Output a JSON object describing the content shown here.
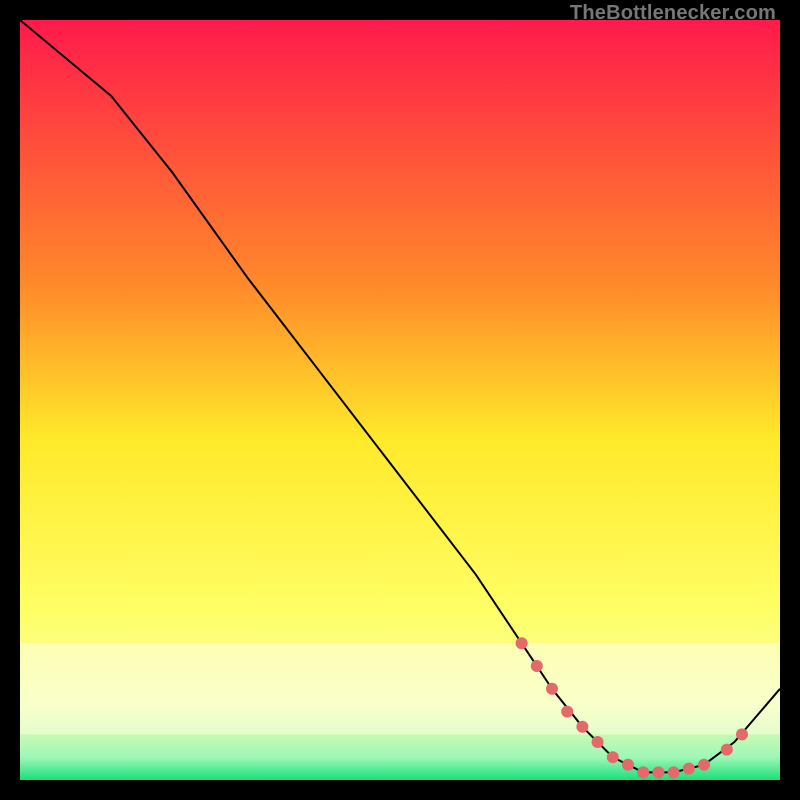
{
  "attribution": "TheBottlenecker.com",
  "colors": {
    "top": "#ff1a4b",
    "mid_upper": "#ff8a2a",
    "mid": "#ffe92a",
    "mid_lower": "#e8ff5a",
    "low_band": "#f7ffb0",
    "bottom": "#18e07a",
    "curve": "#000000",
    "dot": "#e46a6a"
  },
  "chart_data": {
    "type": "line",
    "title": "",
    "xlabel": "",
    "ylabel": "",
    "xlim": [
      0,
      100
    ],
    "ylim": [
      0,
      100
    ],
    "series": [
      {
        "name": "bottleneck-curve",
        "x": [
          0,
          6,
          12,
          20,
          30,
          40,
          50,
          60,
          66,
          70,
          74,
          78,
          82,
          86,
          90,
          94,
          100
        ],
        "y": [
          100,
          95,
          90,
          80,
          66,
          53,
          40,
          27,
          18,
          12,
          7,
          3,
          1,
          1,
          2,
          5,
          12
        ]
      }
    ],
    "dot_clusters": [
      {
        "name": "plateau-dots",
        "x": [
          66,
          68,
          70,
          72,
          74,
          76,
          78,
          80,
          82,
          84,
          86,
          88,
          90,
          93,
          95
        ],
        "y": [
          18,
          15,
          12,
          9,
          7,
          5,
          3,
          2,
          1,
          1,
          1,
          1.5,
          2,
          4,
          6
        ]
      }
    ]
  }
}
